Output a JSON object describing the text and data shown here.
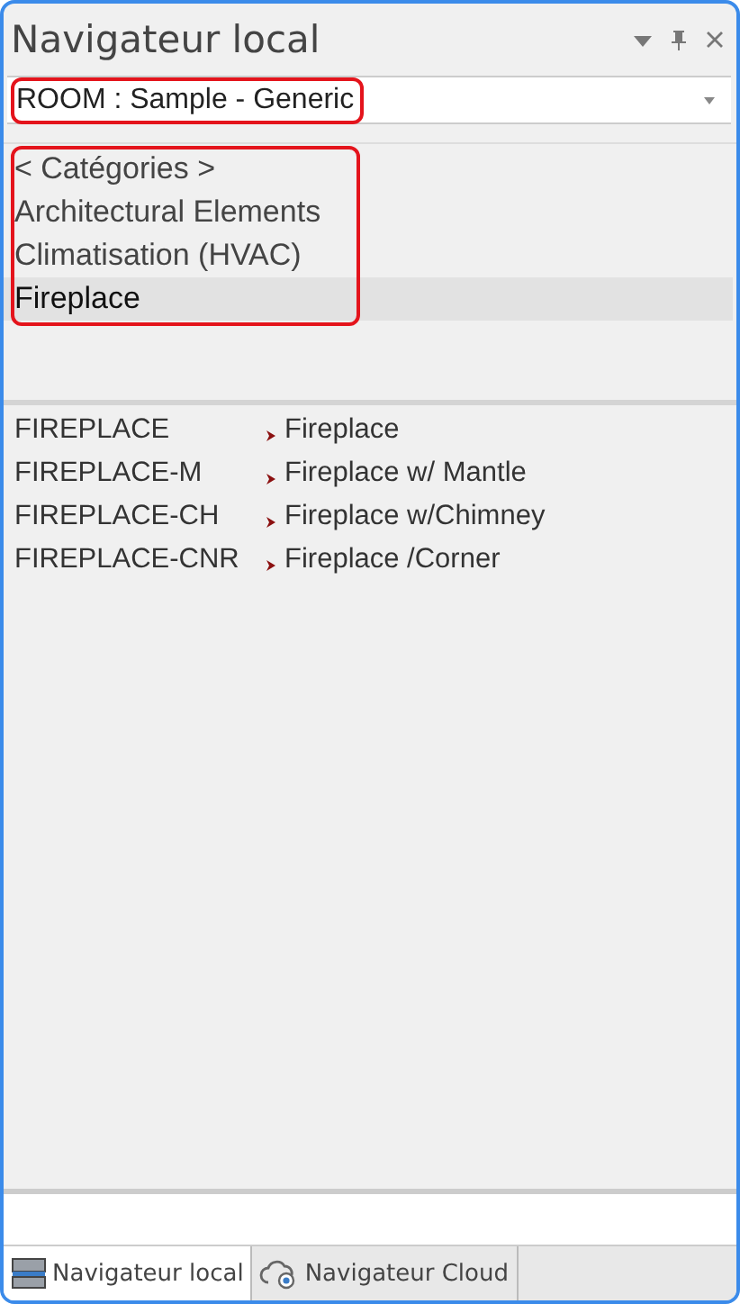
{
  "window": {
    "title": "Navigateur local"
  },
  "title_buttons": [
    {
      "kind": "dropdown"
    },
    {
      "kind": "pin"
    },
    {
      "kind": "close"
    }
  ],
  "room_selector": {
    "value": "ROOM : Sample - Generic",
    "highlighted": true
  },
  "categories": {
    "highlighted": true,
    "items": [
      {
        "label": "< Catégories >",
        "selected": false
      },
      {
        "label": "Architectural Elements",
        "selected": false
      },
      {
        "label": "Climatisation (HVAC)",
        "selected": false
      },
      {
        "label": "Fireplace",
        "selected": true
      }
    ]
  },
  "items": [
    {
      "code": "FIREPLACE",
      "name": "Fireplace"
    },
    {
      "code": "FIREPLACE-M",
      "name": "Fireplace w/ Mantle"
    },
    {
      "code": "FIREPLACE-CH",
      "name": "Fireplace w/Chimney"
    },
    {
      "code": "FIREPLACE-CNR",
      "name": "Fireplace /Corner"
    }
  ],
  "tabs": [
    {
      "label": "Navigateur local",
      "kind": "local",
      "selected": true
    },
    {
      "label": "Navigateur Cloud",
      "kind": "cloud",
      "selected": false
    }
  ]
}
